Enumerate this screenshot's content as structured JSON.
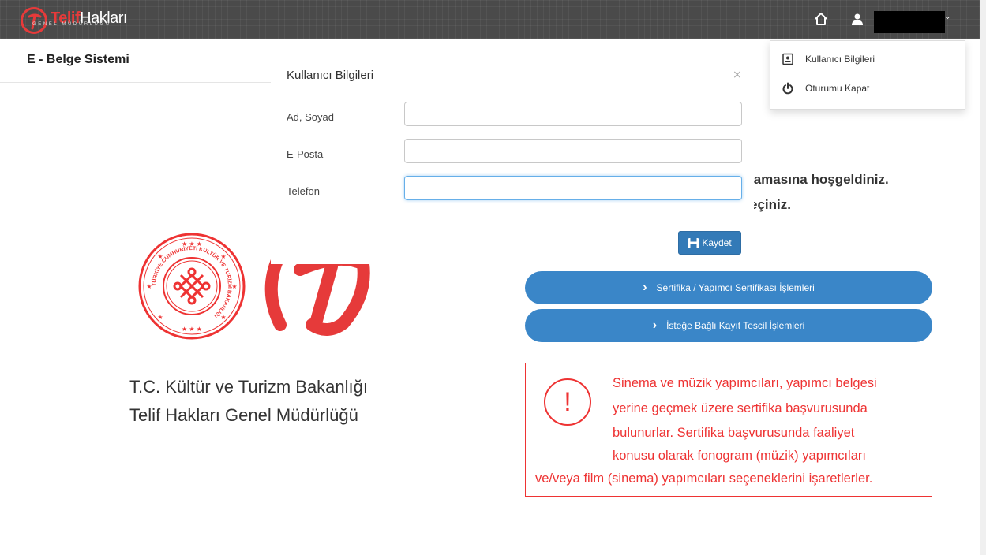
{
  "header": {
    "logo_part1": "Telif",
    "logo_part2": "Hakları",
    "logo_sub": "GENEL MÜDÜRLÜĞÜ"
  },
  "brand": "E - Belge Sistemi",
  "modal": {
    "title": "Kullanıcı Bilgileri",
    "close": "×",
    "fields": [
      {
        "label": "Ad, Soyad",
        "value": ""
      },
      {
        "label": "E-Posta",
        "value": ""
      },
      {
        "label": "Telefon",
        "value": ""
      }
    ],
    "save_label": "Kaydet"
  },
  "welcome": {
    "line1": "lamasına hoşgeldiniz.",
    "line2": "eçiniz."
  },
  "dropdown": {
    "items": [
      {
        "label": "Kullanıcı Bilgileri",
        "icon": "id-card-icon"
      },
      {
        "label": "Oturumu Kapat",
        "icon": "power-icon"
      }
    ]
  },
  "org": {
    "line1": "T.C. Kültür ve Turizm Bakanlığı",
    "line2": "Telif Hakları Genel Müdürlüğü"
  },
  "emblem_text": "TÜRKİYE CUMHURİYETİ KÜLTÜR VE TURİZM BAKANLIĞI",
  "actions": [
    {
      "label": "Sertifika / Yapımcı Sertifikası İşlemleri"
    },
    {
      "label": "İsteğe Bağlı Kayıt Tescil İşlemleri"
    }
  ],
  "alert": {
    "icon": "!",
    "lines": [
      "Sinema ve müzik yapımcıları, yapımcı belgesi",
      "yerine geçmek üzere sertifika başvurusunda",
      "bulunurlar. Sertifika başvurusunda faaliyet",
      "konusu olarak fonogram (müzik) yapımcıları",
      "ve/veya film (sinema) yapımcıları seçeneklerini işaretlerler."
    ]
  },
  "colors": {
    "accent": "#e63a3a",
    "primary_button": "#3a86c8",
    "alert": "#e33333"
  }
}
